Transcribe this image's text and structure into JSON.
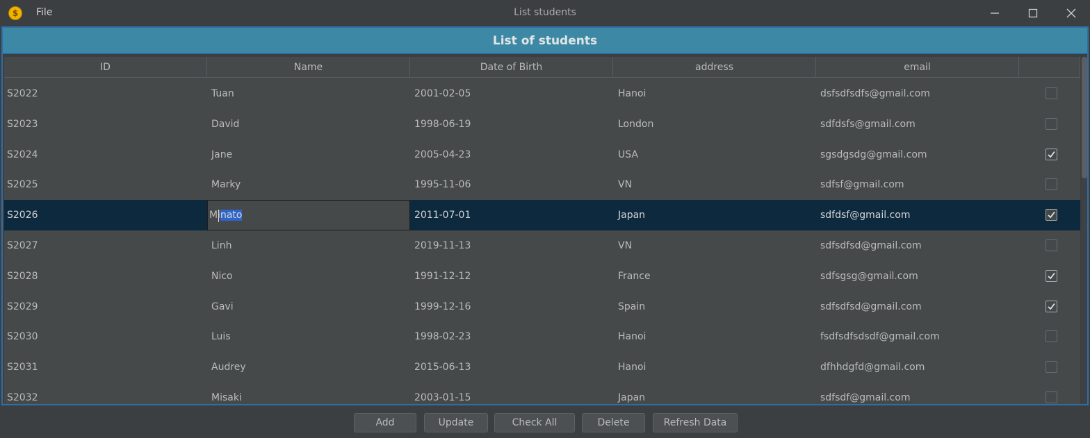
{
  "window": {
    "title": "List students",
    "menu_file": "File",
    "app_icon_glyph": "$"
  },
  "header": {
    "title": "List of students"
  },
  "table": {
    "columns": [
      "ID",
      "Name",
      "Date of Birth",
      "address",
      "email",
      ""
    ],
    "rows": [
      {
        "id": "S2022",
        "name": "Tuan",
        "dob": "2001-02-05",
        "address": "Hanoi",
        "email": "dsfsdfsdfs@gmail.com",
        "checked": false
      },
      {
        "id": "S2023",
        "name": "David",
        "dob": "1998-06-19",
        "address": "London",
        "email": "sdfdsfs@gmail.com",
        "checked": false
      },
      {
        "id": "S2024",
        "name": "Jane",
        "dob": "2005-04-23",
        "address": "USA",
        "email": "sgsdgsdg@gmail.com",
        "checked": true
      },
      {
        "id": "S2025",
        "name": "Marky",
        "dob": "1995-11-06",
        "address": "VN",
        "email": "sdfsf@gmail.com",
        "checked": false
      },
      {
        "id": "S2026",
        "name": "Minato",
        "dob": "2011-07-01",
        "address": "Japan",
        "email": "sdfdsf@gmail.com",
        "checked": true,
        "selected": true
      },
      {
        "id": "S2027",
        "name": "Linh",
        "dob": "2019-11-13",
        "address": "VN",
        "email": "sdfsdfsd@gmail.com",
        "checked": false
      },
      {
        "id": "S2028",
        "name": "Nico",
        "dob": "1991-12-12",
        "address": "France",
        "email": "sdfsgsg@gmail.com",
        "checked": true
      },
      {
        "id": "S2029",
        "name": "Gavi",
        "dob": "1999-12-16",
        "address": "Spain",
        "email": "sdfsdfsd@gmail.com",
        "checked": true
      },
      {
        "id": "S2030",
        "name": "Luis",
        "dob": "1998-02-23",
        "address": "Hanoi",
        "email": "fsdfsdfsdsdf@gmail.com",
        "checked": false
      },
      {
        "id": "S2031",
        "name": "Audrey",
        "dob": "2015-06-13",
        "address": "Hanoi",
        "email": "dfhhdgfd@gmail.com",
        "checked": false
      },
      {
        "id": "S2032",
        "name": "Misaki",
        "dob": "2003-01-15",
        "address": "Japan",
        "email": "sdfsdf@gmail.com",
        "checked": false
      }
    ],
    "editing_cell": {
      "prefix": "Mi",
      "selected_text": "nato"
    }
  },
  "buttons": {
    "add": "Add",
    "update": "Update",
    "check_all": "Check All",
    "delete": "Delete",
    "refresh": "Refresh Data"
  },
  "colors": {
    "header_band": "#3d89a5",
    "selection": "#0d293e",
    "frame_border": "#2f6fa7"
  }
}
